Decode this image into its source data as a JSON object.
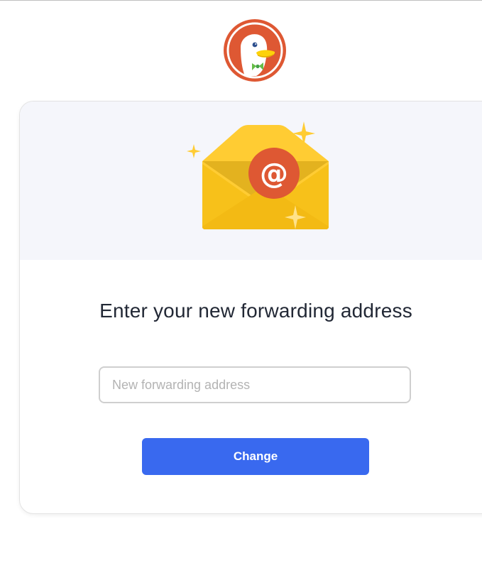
{
  "heading": {
    "title": "Enter your new forwarding address"
  },
  "form": {
    "field_value": "",
    "field_placeholder": "New forwarding address",
    "submit_label": "Change"
  },
  "illustration": {
    "symbol": "@",
    "icon": "envelope-at-icon"
  },
  "logo": {
    "icon": "duckduckgo-logo"
  },
  "colors": {
    "primary_button": "#3969ef",
    "logo_red": "#de5833",
    "envelope_yellow": "#ffcc33",
    "hero_background": "#f5f6fb",
    "heading_text": "#222835"
  }
}
